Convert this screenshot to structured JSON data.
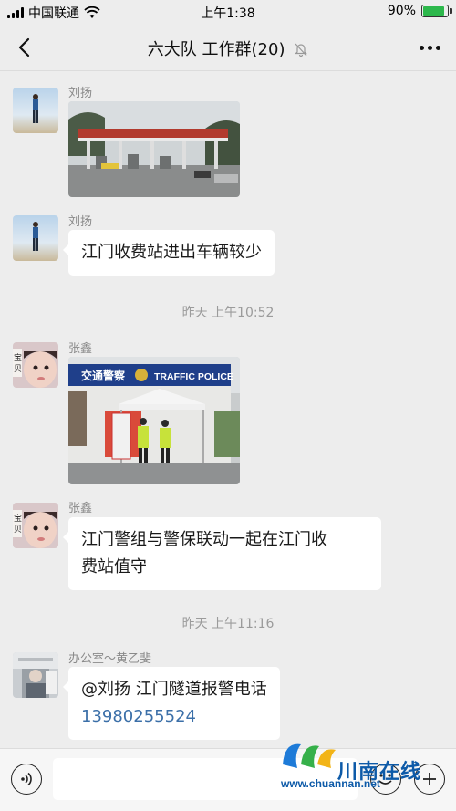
{
  "status_bar": {
    "carrier": "中国联通",
    "time": "上午1:38",
    "battery": "90%",
    "battery_level": 0.9
  },
  "nav": {
    "title": "六大队 工作群(20)"
  },
  "messages": [
    {
      "sender": "刘扬",
      "type": "image",
      "image_desc": "toll-station"
    },
    {
      "sender": "刘扬",
      "type": "text",
      "text": "江门收费站进出车辆较少"
    },
    {
      "type": "time",
      "text": "昨天 上午10:52"
    },
    {
      "sender": "张鑫",
      "type": "image",
      "image_desc": "traffic-police-booth",
      "sign_text": "交通警察",
      "sign_text_en": "TRAFFIC POLICE"
    },
    {
      "sender": "张鑫",
      "type": "text",
      "text_line1": "江门警组与警保联动一起在江门收",
      "text_line2": "费站值守"
    },
    {
      "type": "time",
      "text": "昨天 上午11:16"
    },
    {
      "sender": "办公室～黄乙斐",
      "type": "text",
      "text_line1": "@刘扬 江门隧道报警电话",
      "phone": "13980255524"
    }
  ],
  "watermark": {
    "name": "川南在线",
    "url": "www.chuannan.net"
  },
  "colors": {
    "background": "#ededed",
    "bubble": "#ffffff",
    "link": "#3b6fa8",
    "battery": "#2db84c"
  }
}
